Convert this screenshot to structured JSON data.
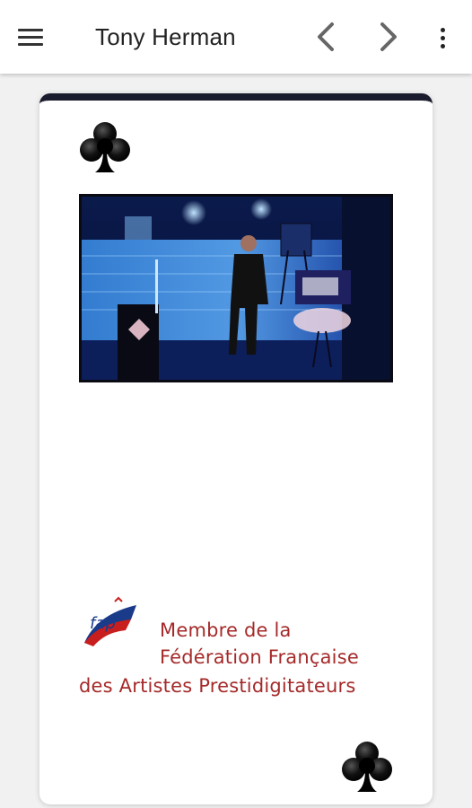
{
  "appbar": {
    "title": "Tony Herman",
    "icons": {
      "menu": "menu-icon",
      "prev": "chevron-left-icon",
      "next": "chevron-right-icon",
      "more": "more-vert-icon"
    }
  },
  "card": {
    "accent_color": "#1b1b2e",
    "suit": "club",
    "membership": {
      "line1": "Membre de la",
      "line2": "Fédération Française",
      "line3": "des Artistes Prestidigitateurs",
      "logo_text": "fap",
      "text_color": "#a52a2a"
    }
  }
}
